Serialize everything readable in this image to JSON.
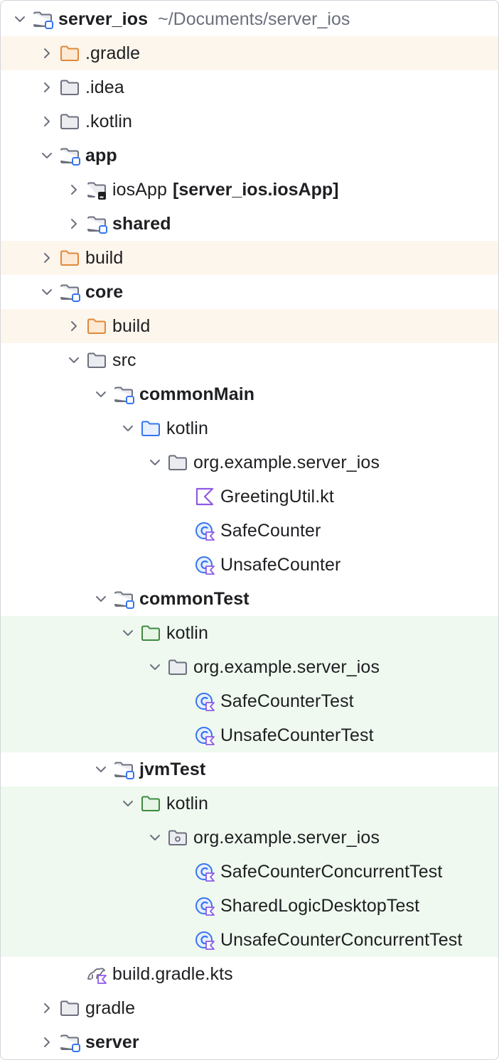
{
  "project_tree": {
    "rows": [
      {
        "label": "server_ios",
        "hint": "~/Documents/server_ios",
        "bold": true,
        "level": 0,
        "expand": "expanded",
        "icon": "module-folder-icon",
        "bg": ""
      },
      {
        "label": ".gradle",
        "level": 1,
        "expand": "collapsed",
        "icon": "excluded-folder-icon",
        "bg": "excluded"
      },
      {
        "label": ".idea",
        "level": 1,
        "expand": "collapsed",
        "icon": "folder-icon",
        "bg": ""
      },
      {
        "label": ".kotlin",
        "level": 1,
        "expand": "collapsed",
        "icon": "folder-icon",
        "bg": ""
      },
      {
        "label": "app",
        "bold": true,
        "level": 1,
        "expand": "expanded",
        "icon": "module-folder-icon",
        "bg": ""
      },
      {
        "label": "iosApp",
        "suffix": "[server_ios.iosApp]",
        "level": 2,
        "expand": "collapsed",
        "icon": "ios-module-folder-icon",
        "bg": ""
      },
      {
        "label": "shared",
        "bold": true,
        "level": 2,
        "expand": "collapsed",
        "icon": "module-folder-icon",
        "bg": ""
      },
      {
        "label": "build",
        "level": 1,
        "expand": "collapsed",
        "icon": "excluded-folder-icon",
        "bg": "excluded"
      },
      {
        "label": "core",
        "bold": true,
        "level": 1,
        "expand": "expanded",
        "icon": "module-folder-icon",
        "bg": ""
      },
      {
        "label": "build",
        "level": 2,
        "expand": "collapsed",
        "icon": "excluded-folder-icon",
        "bg": "excluded"
      },
      {
        "label": "src",
        "level": 2,
        "expand": "expanded",
        "icon": "folder-icon",
        "bg": ""
      },
      {
        "label": "commonMain",
        "bold": true,
        "level": 3,
        "expand": "expanded",
        "icon": "module-folder-icon",
        "bg": ""
      },
      {
        "label": "kotlin",
        "level": 4,
        "expand": "expanded",
        "icon": "source-folder-icon",
        "bg": ""
      },
      {
        "label": "org.example.server_ios",
        "level": 5,
        "expand": "expanded",
        "icon": "package-folder-icon",
        "bg": ""
      },
      {
        "label": "GreetingUtil.kt",
        "level": 6,
        "expand": "none",
        "icon": "kotlin-file-icon",
        "bg": ""
      },
      {
        "label": "SafeCounter",
        "level": 6,
        "expand": "none",
        "icon": "kotlin-class-icon",
        "bg": ""
      },
      {
        "label": "UnsafeCounter",
        "level": 6,
        "expand": "none",
        "icon": "kotlin-class-icon",
        "bg": ""
      },
      {
        "label": "commonTest",
        "bold": true,
        "level": 3,
        "expand": "expanded",
        "icon": "module-folder-icon",
        "bg": ""
      },
      {
        "label": "kotlin",
        "level": 4,
        "expand": "expanded",
        "icon": "test-folder-icon",
        "bg": "test"
      },
      {
        "label": "org.example.server_ios",
        "level": 5,
        "expand": "expanded",
        "icon": "package-folder-icon",
        "bg": "test"
      },
      {
        "label": "SafeCounterTest",
        "level": 6,
        "expand": "none",
        "icon": "kotlin-class-icon",
        "bg": "test"
      },
      {
        "label": "UnsafeCounterTest",
        "level": 6,
        "expand": "none",
        "icon": "kotlin-class-icon",
        "bg": "test"
      },
      {
        "label": "jvmTest",
        "bold": true,
        "level": 3,
        "expand": "expanded",
        "icon": "module-folder-icon",
        "bg": ""
      },
      {
        "label": "kotlin",
        "level": 4,
        "expand": "expanded",
        "icon": "test-folder-icon",
        "bg": "test"
      },
      {
        "label": "org.example.server_ios",
        "level": 5,
        "expand": "expanded",
        "icon": "package-dot-folder-icon",
        "bg": "test"
      },
      {
        "label": "SafeCounterConcurrentTest",
        "level": 6,
        "expand": "none",
        "icon": "kotlin-class-icon",
        "bg": "test"
      },
      {
        "label": "SharedLogicDesktopTest",
        "level": 6,
        "expand": "none",
        "icon": "kotlin-class-icon",
        "bg": "test"
      },
      {
        "label": "UnsafeCounterConcurrentTest",
        "level": 6,
        "expand": "none",
        "icon": "kotlin-class-icon",
        "bg": "test"
      },
      {
        "label": "build.gradle.kts",
        "level": 2,
        "expand": "none",
        "icon": "gradle-kts-file-icon",
        "bg": ""
      },
      {
        "label": "gradle",
        "level": 1,
        "expand": "collapsed",
        "icon": "folder-icon",
        "bg": ""
      },
      {
        "label": "server",
        "bold": true,
        "level": 1,
        "expand": "collapsed",
        "icon": "module-folder-icon",
        "bg": ""
      }
    ]
  },
  "colors": {
    "excluded_bg": "#fdf6ec",
    "test_bg": "#eff9ef",
    "folder_stroke": "#6c707e",
    "excluded_stroke": "#e0883a",
    "source_stroke": "#3574f0",
    "test_stroke": "#3d8a40",
    "kotlin": "#8e5ae6",
    "module_badge": "#3574f0"
  }
}
